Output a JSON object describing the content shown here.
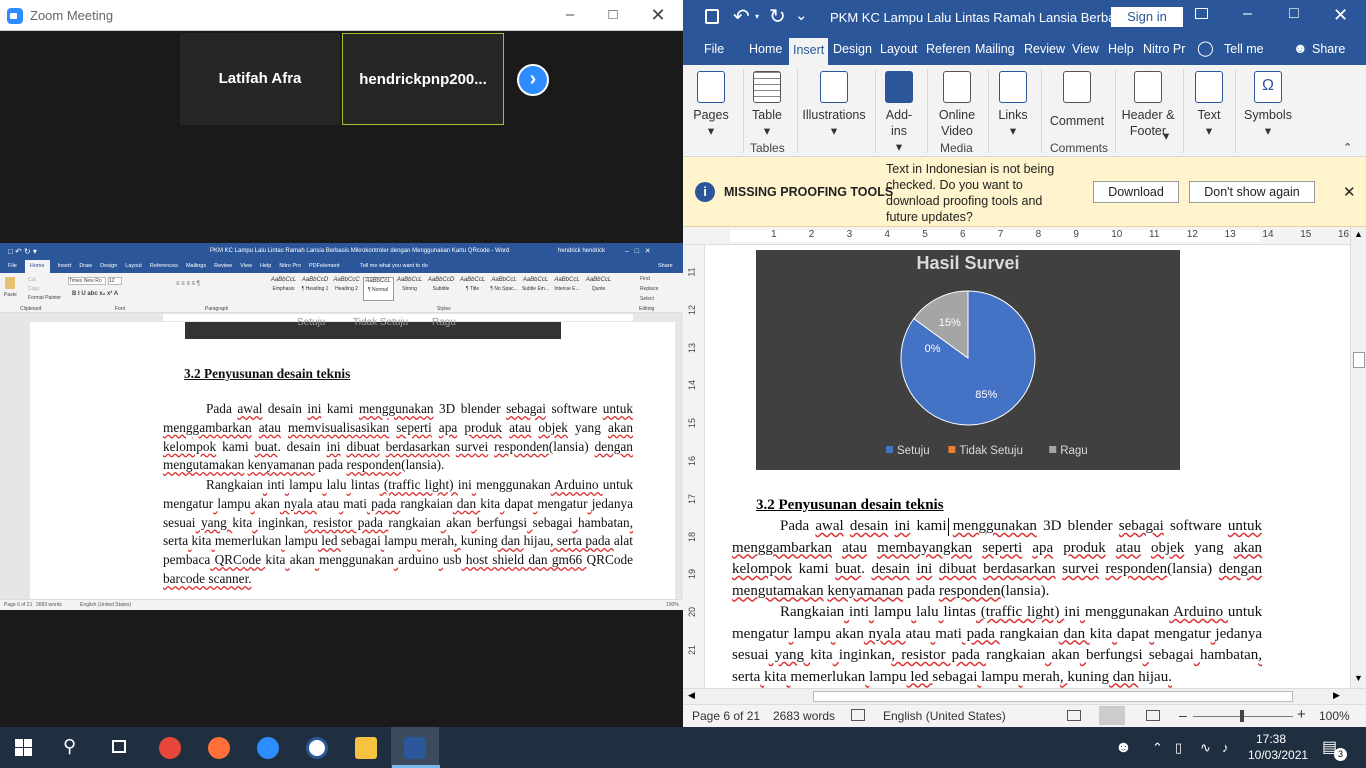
{
  "zoom": {
    "title": "Zoom Meeting",
    "participants": [
      {
        "name": "Latifah Afra"
      },
      {
        "name": "hendrickpnp200..."
      }
    ],
    "share": {
      "doc_title": "PKM KC Lampu Lalu Lintas Ramah Lansia Berbasis Mikrokontroler dengan Menggunakan Kartu QRcode - Word",
      "user": "hendrick hendrick",
      "tabs": [
        "File",
        "Home",
        "Insert",
        "Draw",
        "Design",
        "Layout",
        "References",
        "Mailings",
        "Review",
        "View",
        "Help",
        "Nitro Pro",
        "PDFelement"
      ],
      "tell_me": "Tell me what you want to do",
      "share_label": "Share",
      "font_name": "Times New Ro",
      "font_size": "12",
      "clipboard": {
        "paste": "Paste",
        "cut": "Cut",
        "copy": "Copy",
        "format_painter": "Format Painter"
      },
      "group_labels": {
        "clipboard": "Clipboard",
        "font": "Font",
        "paragraph": "Paragraph",
        "styles": "Styles",
        "editing": "Editing"
      },
      "styles": [
        {
          "prev": "AaBbCcL",
          "name": "Emphasis"
        },
        {
          "prev": "AaBbCcD",
          "name": "¶ Heading 1"
        },
        {
          "prev": "AaBbCcC",
          "name": "Heading 2"
        },
        {
          "prev": "AaBbCcL",
          "name": "¶ Normal"
        },
        {
          "prev": "AaBbCcL",
          "name": "Strong"
        },
        {
          "prev": "AaBbCcD",
          "name": "Subtitle"
        },
        {
          "prev": "AaBbCcL",
          "name": "¶ Title"
        },
        {
          "prev": "AaBbCcL",
          "name": "¶ No Spac..."
        },
        {
          "prev": "AaBbCcL",
          "name": "Subtle Em..."
        },
        {
          "prev": "AaBbCcL",
          "name": "Intense E..."
        },
        {
          "prev": "AaBbCcL",
          "name": "Quote"
        }
      ],
      "editing": {
        "find": "Find",
        "replace": "Replace",
        "select": "Select"
      },
      "legend": [
        "Setuju",
        "Tidak Setuju",
        "Ragu"
      ],
      "heading": "3.2 Penyusunan desain teknis",
      "p1": [
        "Pada ",
        "awal",
        " desain ",
        "ini",
        " kami ",
        "menggunakan",
        " 3D blender ",
        "sebagai",
        " software ",
        "untuk",
        " ",
        "menggambarkan",
        " ",
        "atau",
        " ",
        "memvisualisasikan",
        " ",
        "seperti",
        " ",
        "apa",
        " ",
        "produk",
        " ",
        "atau",
        " ",
        "objek",
        " yang ",
        "akan",
        " ",
        "kelompok",
        " kami ",
        "buat",
        ". desain ",
        "ini",
        " ",
        "dibuat",
        " ",
        "berdasarkan",
        " ",
        "survei",
        " ",
        "responden",
        "(lansia) ",
        "dengan",
        " ",
        "mengutamakan",
        " ",
        "kenyamanan",
        " pada ",
        "responden",
        "(lansia)."
      ],
      "p2": [
        "Rangkaian",
        " ",
        "inti",
        " ",
        "lampu",
        " ",
        "lalu",
        " ",
        "lintas",
        " (traffic light) ",
        "ini",
        " ",
        "menggunakan",
        " Arduino ",
        "untuk",
        " ",
        "mengatur",
        " ",
        "lampu",
        " ",
        "akan",
        " nyala ",
        "atau",
        " ",
        "mati",
        " pada ",
        "rangkaian",
        " dan ",
        "kita",
        " ",
        "dapat",
        " ",
        "mengatur",
        " ",
        "jedanya",
        " ",
        "sesuai",
        " yang ",
        "kita",
        " ",
        "inginkan",
        ", resistor pada ",
        "rangkaian",
        " ",
        "akan",
        " ",
        "berfungsi",
        " ",
        "sebagai",
        " ",
        "hambatan",
        ", ",
        "serta",
        " ",
        "kita",
        " ",
        "memerlukan",
        " ",
        "lampu",
        " led ",
        "sebagai",
        " ",
        "lampu",
        " ",
        "merah",
        ", ",
        "kuning",
        " dan ",
        "hijau",
        ", serta pada ",
        "alat",
        " ",
        "pembaca",
        " QRCode ",
        "kita",
        " ",
        "akan",
        " ",
        "menggunakan",
        " ",
        "arduino",
        " ",
        "usb",
        " host shield dan gm66 ",
        "QRCode",
        " barcode scanner."
      ],
      "status_page": "Page 6 of 21",
      "status_words": "2683 words",
      "status_lang": "English (United States)",
      "status_zoom": "100%"
    }
  },
  "word": {
    "title": "PKM KC Lampu Lalu Lintas Ramah Lansia Berbasi...",
    "sign_in": "Sign in",
    "tabs": [
      "File",
      "Home",
      "Insert",
      "Design",
      "Layout",
      "Referen",
      "Mailing",
      "Review",
      "View",
      "Help",
      "Nitro Pr"
    ],
    "tell_me": "Tell me",
    "share": "Share",
    "ribbon": {
      "pages": "Pages",
      "table": "Table",
      "illustrations": "Illustrations",
      "addins": "Add-ins",
      "online_video": "Online Video",
      "links": "Links",
      "comment": "Comment",
      "header_footer": "Header & Footer",
      "text": "Text",
      "symbols": "Symbols",
      "groups": {
        "tables": "Tables",
        "media": "Media",
        "comments": "Comments"
      }
    },
    "message": {
      "title": "MISSING PROOFING TOOLS",
      "body": "Text in Indonesian is not being checked. Do you want to download proofing tools and future updates?",
      "download": "Download",
      "dont_show": "Don't show again"
    },
    "ruler_numbers": [
      "1",
      "2",
      "3",
      "4",
      "5",
      "6",
      "7",
      "8",
      "9",
      "10",
      "11",
      "12",
      "13",
      "14",
      "15",
      "16"
    ],
    "vruler_numbers": [
      "11",
      "12",
      "13",
      "14",
      "15",
      "16",
      "17",
      "18",
      "19",
      "20",
      "21"
    ],
    "chart_data": {
      "type": "pie",
      "title": "Hasil Survei",
      "categories": [
        "Setuju",
        "Tidak Setuju",
        "Ragu"
      ],
      "values": [
        85,
        0,
        15
      ],
      "labels": [
        "85%",
        "0%",
        "15%"
      ],
      "colors": [
        "#4472c4",
        "#ed7d31",
        "#a5a5a5"
      ],
      "legend_position": "bottom"
    },
    "heading": "3.2 Penyusunan desain teknis",
    "p1": [
      "Pada ",
      "awal",
      " ",
      "desain",
      " ",
      "ini",
      " kami ",
      "menggunakan",
      " 3D blender ",
      "sebagai",
      " software ",
      "untuk",
      " ",
      "menggambarkan",
      " ",
      "atau",
      " ",
      "membayangkan",
      " ",
      "seperti",
      " ",
      "apa",
      " ",
      "produk",
      " ",
      "atau",
      " ",
      "objek",
      " yang ",
      "akan",
      " ",
      "kelompok",
      " kami ",
      "buat",
      ". ",
      "desain",
      " ",
      "ini",
      " ",
      "dibuat",
      " ",
      "berdasarkan",
      " ",
      "survei",
      " ",
      "responden",
      "(lansia) ",
      "dengan",
      " ",
      "mengutamakan",
      " ",
      "kenyamanan",
      " pada ",
      "responden",
      "(lansia)."
    ],
    "p2": [
      "Rangkaian",
      " ",
      "inti",
      " ",
      "lampu",
      " ",
      "lalu",
      " ",
      "lintas",
      " (traffic light) ",
      "ini",
      " ",
      "menggunakan",
      " Arduino ",
      "untuk",
      " ",
      "mengatur",
      " ",
      "lampu",
      " ",
      "akan",
      " nyala ",
      "atau",
      " ",
      "mati",
      " pada ",
      "rangkaian",
      " dan ",
      "kita",
      " ",
      "dapat",
      " ",
      "mengatur",
      " ",
      "jedanya",
      " ",
      "sesuai",
      " yang ",
      "kita",
      " ",
      "inginkan",
      ", resistor pada ",
      "rangkaian",
      " ",
      "akan",
      " ",
      "berfungsi",
      " ",
      "sebagai",
      " ",
      "hambatan",
      ", ",
      "serta",
      " ",
      "kita",
      " ",
      "memerlukan",
      " ",
      "lampu",
      " led ",
      "sebagai",
      " ",
      "lampu",
      " ",
      "merah",
      ", ",
      "kuning",
      " dan ",
      "hijau",
      "."
    ],
    "status": {
      "page": "Page 6 of 21",
      "words": "2683 words",
      "language": "English (United States)",
      "zoom": "100%"
    }
  },
  "taskbar": {
    "apps": [
      {
        "icon": "chrome-icon",
        "color": "#e8453c"
      },
      {
        "icon": "firefox-icon",
        "color": "#ff7139"
      },
      {
        "icon": "zoom-icon",
        "color": "#2d8cff"
      },
      {
        "icon": "nitro-icon",
        "color": "#ffffff"
      },
      {
        "icon": "file-explorer-icon",
        "color": "#f5c242"
      },
      {
        "icon": "word-icon",
        "color": "#2b579a"
      }
    ],
    "time": "17:38",
    "date": "10/03/2021",
    "notifications": "3"
  }
}
